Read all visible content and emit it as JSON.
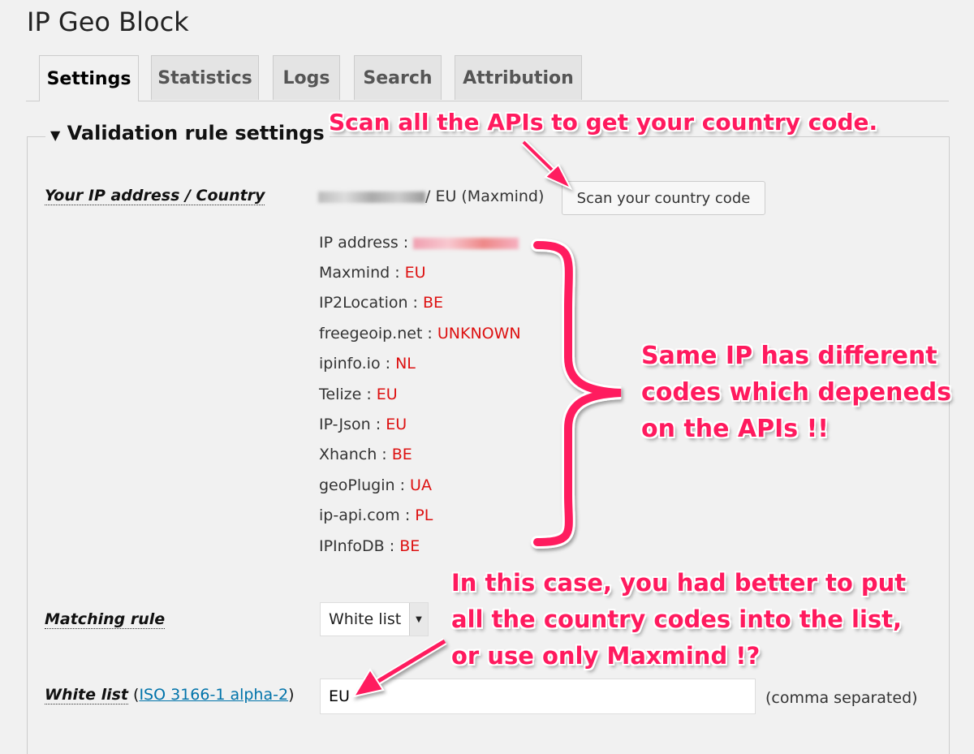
{
  "title": "IP Geo Block",
  "tabs": [
    {
      "label": "Settings",
      "active": true
    },
    {
      "label": "Statistics"
    },
    {
      "label": "Logs"
    },
    {
      "label": "Search"
    },
    {
      "label": "Attribution"
    }
  ],
  "section": {
    "title": "Validation rule settings"
  },
  "ip_row": {
    "label": "Your IP address / Country",
    "value": "/ EU (Maxmind)",
    "button": "Scan your country code"
  },
  "scan_results": {
    "ip_label": "IP address :",
    "items": [
      {
        "api": "Maxmind :",
        "code": "EU"
      },
      {
        "api": "IP2Location :",
        "code": "BE"
      },
      {
        "api": "freegeoip.net :",
        "code": "UNKNOWN"
      },
      {
        "api": "ipinfo.io :",
        "code": "NL"
      },
      {
        "api": "Telize :",
        "code": "EU"
      },
      {
        "api": "IP-Json :",
        "code": "EU"
      },
      {
        "api": "Xhanch :",
        "code": "BE"
      },
      {
        "api": "geoPlugin :",
        "code": "UA"
      },
      {
        "api": "ip-api.com :",
        "code": "PL"
      },
      {
        "api": "IPInfoDB :",
        "code": "BE"
      }
    ]
  },
  "matching_rule": {
    "label": "Matching rule",
    "selected": "White list"
  },
  "white_list": {
    "label": "White list",
    "paren_open": " (",
    "link": "ISO 3166-1 alpha-2",
    "paren_close": ")",
    "value": "EU",
    "hint": "(comma separated)"
  },
  "annotations": {
    "scan": "Scan all the APIs to get your country code.",
    "codes": "Same IP has different\ncodes which depeneds\non the APIs !!",
    "advice": "In this case, you had better to put\nall the country codes into the list,\nor use only Maxmind !?",
    "color": "#ff1a5e"
  }
}
